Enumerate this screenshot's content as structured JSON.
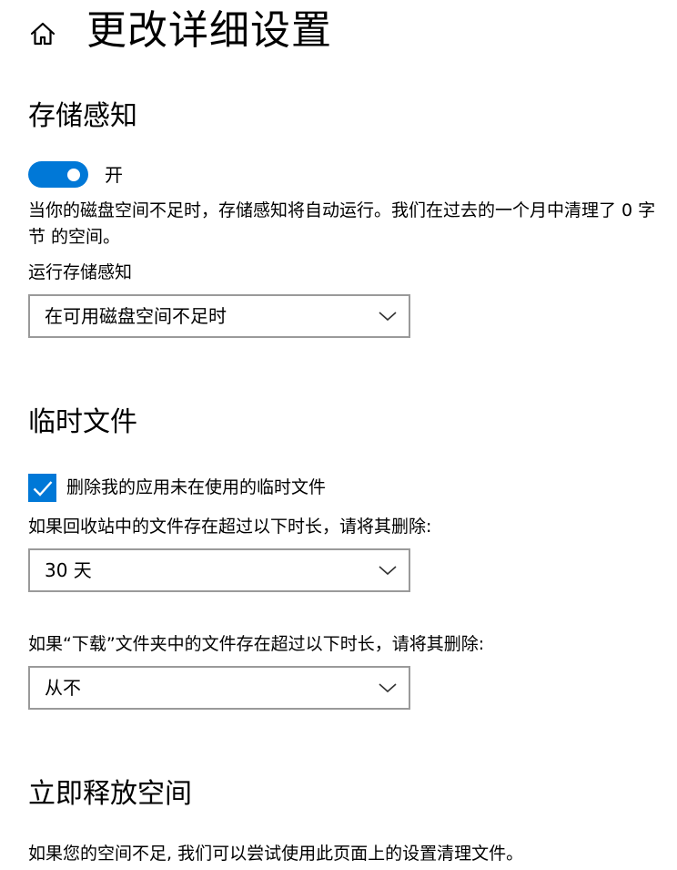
{
  "header": {
    "title": "更改详细设置"
  },
  "storage_sense": {
    "heading": "存储感知",
    "toggle_state_label": "开",
    "description": "当你的磁盘空间不足时，存储感知将自动运行。我们在过去的一个月中清理了 0 字节 的空间。",
    "run_label": "运行存储感知",
    "run_value": "在可用磁盘空间不足时"
  },
  "temp_files": {
    "heading": "临时文件",
    "checkbox_label": "删除我的应用未在使用的临时文件",
    "checkbox_checked": true,
    "recycle_label": "如果回收站中的文件存在超过以下时长，请将其删除:",
    "recycle_value": "30 天",
    "downloads_label": "如果“下载”文件夹中的文件存在超过以下时长，请将其删除:",
    "downloads_value": "从不"
  },
  "free_space": {
    "heading": "立即释放空间",
    "description": "如果您的空间不足, 我们可以尝试使用此页面上的设置清理文件。"
  },
  "colors": {
    "accent": "#0078d7",
    "dropdown_border": "#9a9a9a"
  },
  "icons": {
    "home": "home-icon",
    "chevron": "chevron-down-icon",
    "check": "checkmark-icon"
  }
}
